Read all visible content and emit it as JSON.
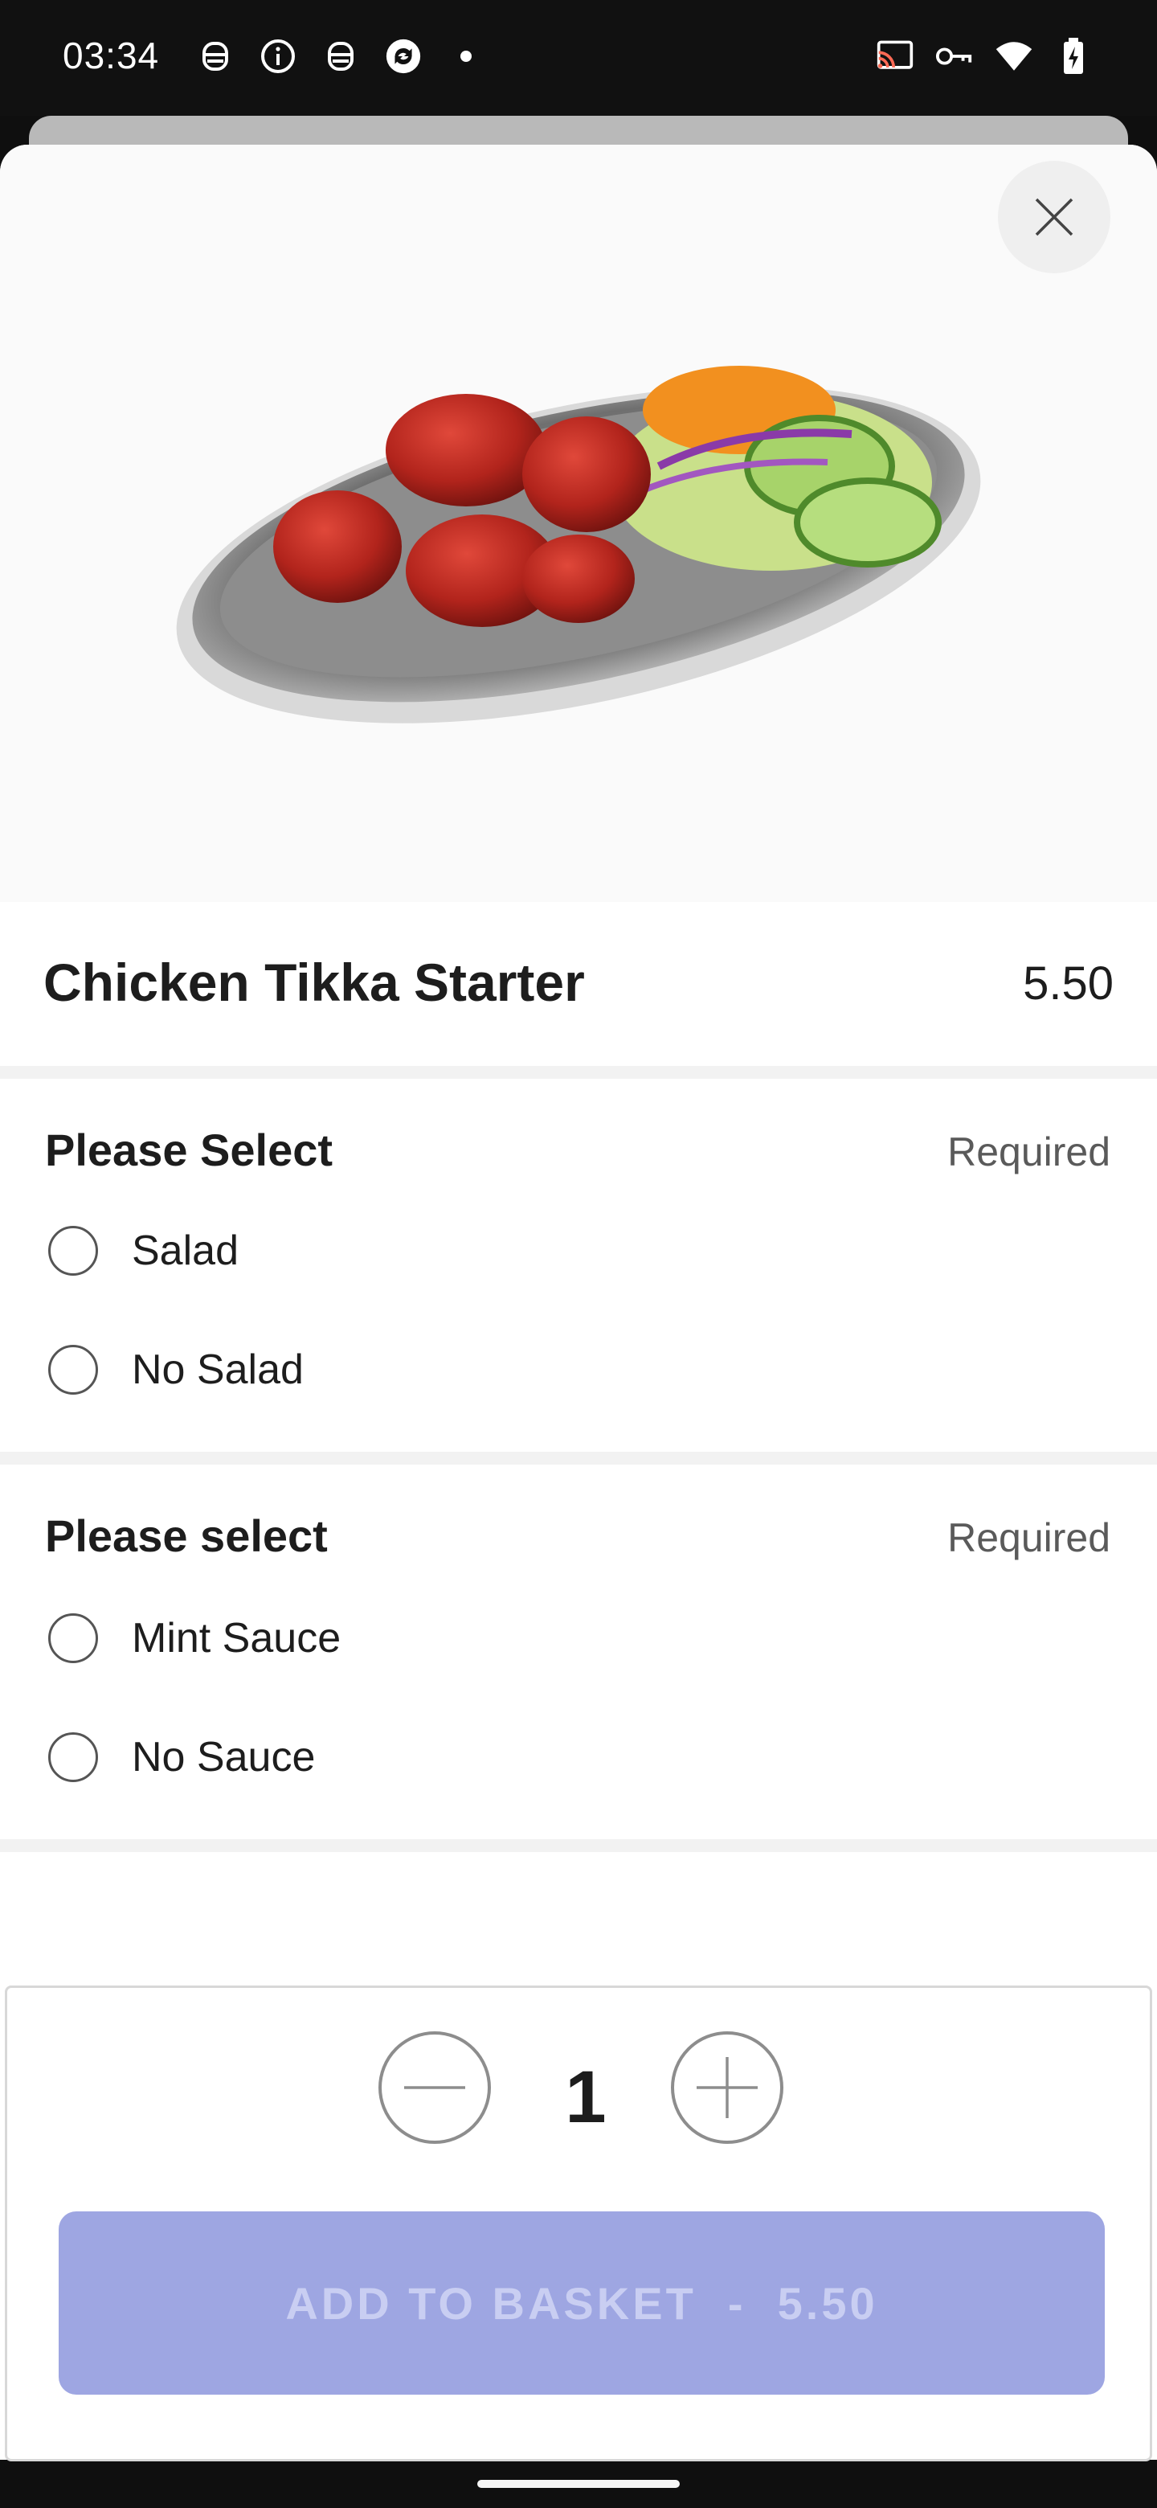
{
  "status_bar": {
    "time": "03:34",
    "left_icons": [
      "notification-icon",
      "info-icon",
      "notification-icon",
      "sync-icon",
      "dot-icon"
    ],
    "right_icons": [
      "cast-icon",
      "key-icon",
      "wifi-icon",
      "battery-icon"
    ]
  },
  "item": {
    "name": "Chicken Tikka Starter",
    "price": "5.50"
  },
  "groups": [
    {
      "title": "Please Select",
      "badge": "Required",
      "options": [
        "Salad",
        "No Salad"
      ]
    },
    {
      "title": "Please select",
      "badge": "Required",
      "options": [
        "Mint Sauce",
        "No Sauce"
      ]
    }
  ],
  "quantity": {
    "value": "1"
  },
  "cta": {
    "label": "ADD TO BASKET  -  5.50"
  },
  "colors": {
    "cta_bg": "#9ea6e2",
    "cta_text": "#c9cef2",
    "sheet_bg": "#ffffff",
    "status_bg": "#111111"
  }
}
